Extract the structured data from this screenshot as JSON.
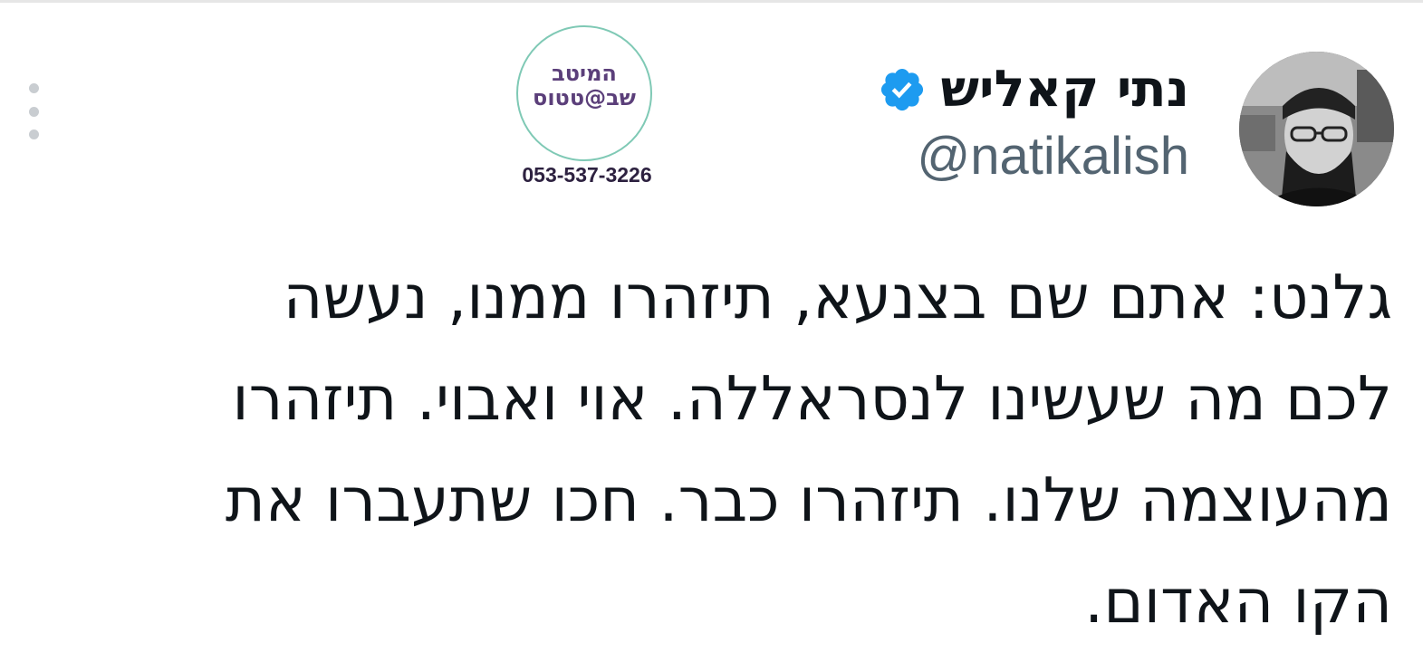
{
  "tweet": {
    "author": {
      "display_name": "נתי קאליש",
      "handle": "@natikalish",
      "verified": true,
      "verified_color": "#1d9bf0"
    },
    "text_lines": [
      "גלנט: אתם שם בצנעא, תיזהרו ממנו, נעשה",
      "לכם מה שעשינו לנסראללה. אוי ואבוי. תיזהרו",
      "מהעוצמה שלנו. תיזהרו כבר. חכו שתעברו את",
      "הקו האדום."
    ],
    "more_icon": "ellipsis-vertical-icon"
  },
  "watermark": {
    "logo_line1": "המיטב",
    "logo_line2": "שב@טטוס",
    "phone": "053-537-3226",
    "accent_color": "#7fc9b5",
    "text_color": "#5b3f7a"
  }
}
